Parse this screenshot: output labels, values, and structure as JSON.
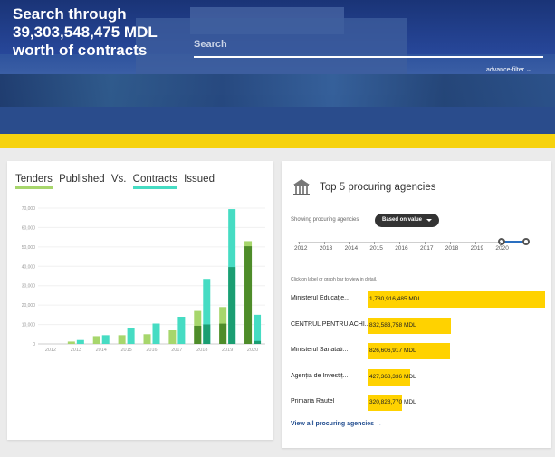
{
  "hero": {
    "title_line1": "Search through",
    "title_line2": "39,303,548,475 MDL",
    "title_line3": "worth of contracts",
    "search_placeholder": "Search",
    "advance_filter": "advance-filter ⌄"
  },
  "left_card": {
    "tab_tenders": "Tenders",
    "tab_published": "Published",
    "tab_vs": "Vs.",
    "tab_contracts": "Contracts",
    "tab_issued": "Issued"
  },
  "chart_data": {
    "type": "bar",
    "ylim": [
      0,
      70000
    ],
    "yticks": [
      "0",
      "10,000",
      "20,000",
      "30,000",
      "40,000",
      "50,000",
      "60,000",
      "70,000"
    ],
    "categories": [
      "2012",
      "2013",
      "2014",
      "2015",
      "2016",
      "2017",
      "2018",
      "2019",
      "2020"
    ],
    "series": [
      {
        "values": [
          0,
          1200,
          4000,
          4500,
          5000,
          7000,
          17000,
          19000,
          53000
        ]
      },
      {
        "values": [
          0,
          2000,
          4500,
          8000,
          10500,
          14000,
          33500,
          69500,
          15000
        ]
      }
    ],
    "colors": {
      "tenders_light": "#a7d66c",
      "tenders_dark": "#4e8c2a",
      "contracts_light": "#46dcc3",
      "contracts_dark": "#1b9e72"
    }
  },
  "right_card": {
    "title": "Top 5 procuring agencies",
    "showing_label": "Showing procuring agencies",
    "based_on": "Based on value",
    "years": [
      "2012",
      "2013",
      "2014",
      "2015",
      "2016",
      "2017",
      "2018",
      "2019",
      "2020"
    ],
    "hint": "Click on label or graph bar to view in detail.",
    "view_all": "View all procuring agencies →",
    "agencies": [
      {
        "name": "Ministerul Educație...",
        "value": "1,780,916,485 MDL",
        "amount": 1780916485
      },
      {
        "name": "CENTRUL PENTRU ACHI...",
        "value": "832,583,758 MDL",
        "amount": 832583758
      },
      {
        "name": "Ministerul Sanatati...",
        "value": "826,606,917 MDL",
        "amount": 826606917
      },
      {
        "name": "Agenția de Investiț...",
        "value": "427,368,336 MDL",
        "amount": 427368336
      },
      {
        "name": "Primaria Rautel",
        "value": "320,828,770 MDL",
        "amount": 320828770
      }
    ]
  }
}
